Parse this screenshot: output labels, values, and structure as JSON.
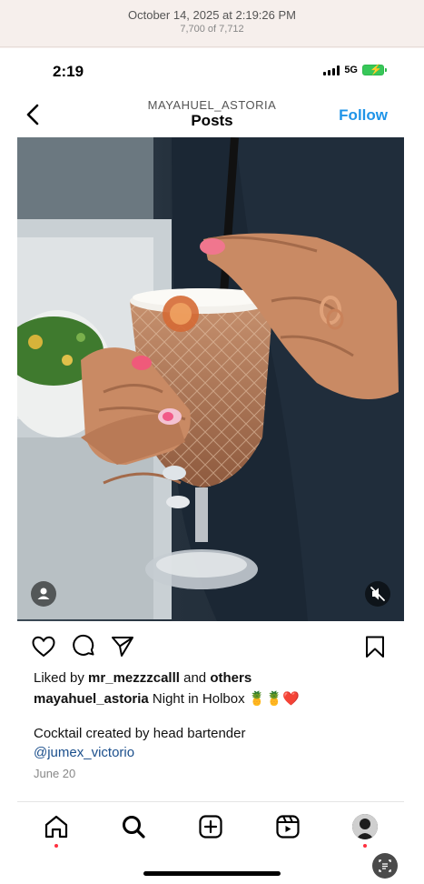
{
  "meta": {
    "date": "October 14, 2025 at 2:19:26 PM",
    "count": "7,700 of 7,712"
  },
  "status": {
    "time": "2:19",
    "network": "5G"
  },
  "header": {
    "username": "MAYAHUEL_ASTORIA",
    "title": "Posts",
    "follow_label": "Follow"
  },
  "post": {
    "likes_prefix": "Liked by ",
    "liked_by": "mr_mezzzcalll",
    "likes_mid": " and ",
    "likes_others": "others",
    "caption_user": "mayahuel_astoria",
    "caption_text": " Night in Holbox 🍍🍍❤️",
    "caption_line2": " Cocktail created by head bartender",
    "mention": "@jumex_victorio",
    "date": "June 20"
  },
  "icons": {
    "actions": [
      "heart-icon",
      "comment-icon",
      "share-icon",
      "bookmark-icon"
    ],
    "tabs": [
      "home-icon",
      "search-icon",
      "create-icon",
      "reels-icon",
      "profile-avatar"
    ]
  },
  "colors": {
    "accent": "#1f94e8",
    "link": "#1b4f8c",
    "notification": "#ff3040"
  }
}
